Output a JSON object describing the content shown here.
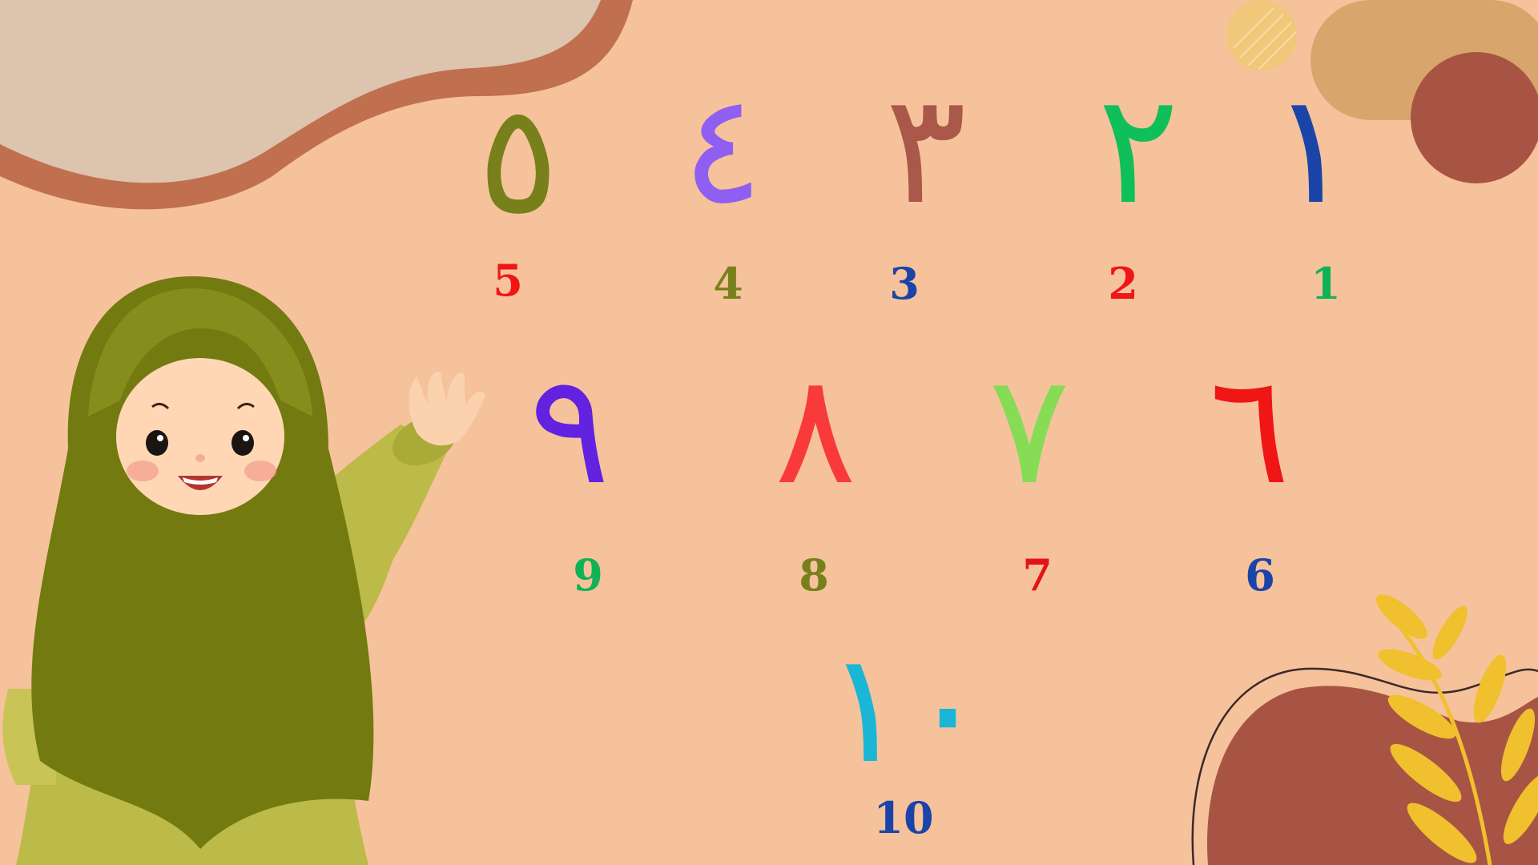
{
  "numbers": [
    {
      "arabic": "١",
      "latin": "1",
      "arabic_color": "#1b44a8",
      "latin_color": "#0fb257"
    },
    {
      "arabic": "٢",
      "latin": "2",
      "arabic_color": "#0fbf5a",
      "latin_color": "#f01616"
    },
    {
      "arabic": "٣",
      "latin": "3",
      "arabic_color": "#a9584a",
      "latin_color": "#1b44a8"
    },
    {
      "arabic": "٤",
      "latin": "4",
      "arabic_color": "#8f5ff2",
      "latin_color": "#78801b"
    },
    {
      "arabic": "٥",
      "latin": "5",
      "arabic_color": "#78801b",
      "latin_color": "#f01616"
    },
    {
      "arabic": "٦",
      "latin": "6",
      "arabic_color": "#f01616",
      "latin_color": "#1b44a8"
    },
    {
      "arabic": "٧",
      "latin": "7",
      "arabic_color": "#86dc55",
      "latin_color": "#e51414"
    },
    {
      "arabic": "٨",
      "latin": "8",
      "arabic_color": "#f83a3a",
      "latin_color": "#78801b"
    },
    {
      "arabic": "٩",
      "latin": "9",
      "arabic_color": "#6222e0",
      "latin_color": "#0fb257"
    },
    {
      "arabic": "١٠",
      "latin": "10",
      "arabic_color": "#1bb6d6",
      "latin_color": "#1b44a8"
    }
  ],
  "colors": {
    "background": "#f6c29b",
    "blob_top_left": "#dcc4ae",
    "blob_top_left_border": "#c0704f",
    "pill_top_right": "#d8a56c",
    "circle_top_right": "#a85444",
    "blob_bottom_right": "#a85444",
    "leaf": "#f0c02e",
    "hijab": "#737a10",
    "dress": "#bcba48",
    "skin": "#ffd7b5"
  },
  "icons": {
    "girl": "girl-waving-illustration",
    "leaf": "leaf-branch-icon"
  }
}
